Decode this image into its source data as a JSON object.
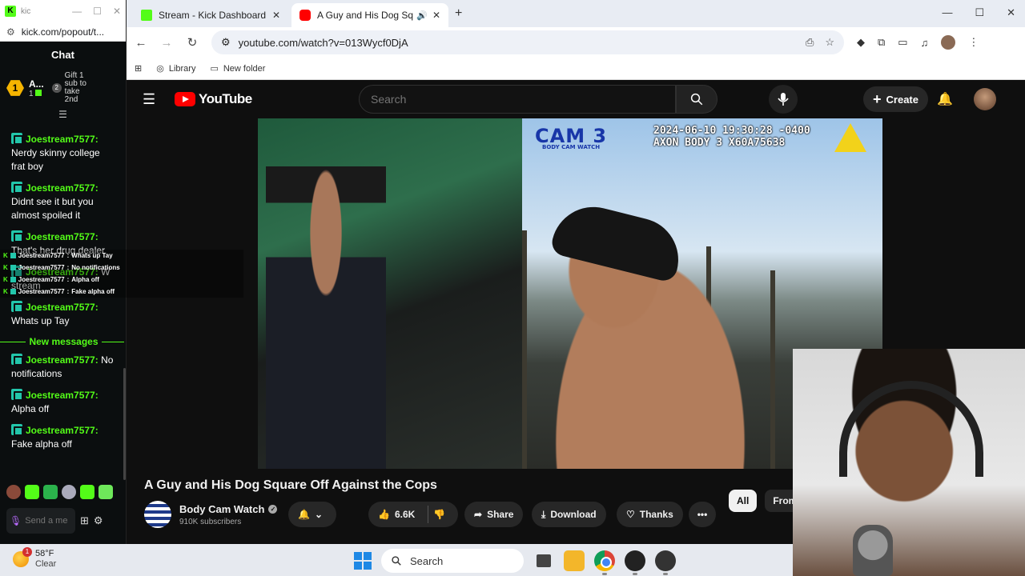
{
  "kick_popout": {
    "window_title": "kic",
    "url": "kick.com/popout/t...",
    "chat_header": "Chat",
    "gift_banner": {
      "rank": "1",
      "name": "A...",
      "count": "1",
      "second_rank": "2",
      "gift_text": "Gift 1 sub to take 2nd"
    },
    "messages": [
      {
        "user": "Joestream7577:",
        "text": "Nerdy skinny college frat boy"
      },
      {
        "user": "Joestream7577:",
        "text": "Didnt see it but you almost spoiled it"
      },
      {
        "user": "Joestream7577:",
        "text": "That's her drug dealer"
      },
      {
        "user": "Joestream7577:",
        "text": "W stream"
      },
      {
        "user": "Joestream7577:",
        "text": "Whats up Tay"
      }
    ],
    "new_messages_label": "New messages",
    "new_messages": [
      {
        "user": "Joestream7577:",
        "text": "No notifications"
      },
      {
        "user": "Joestream7577:",
        "text": "Alpha off"
      },
      {
        "user": "Joestream7577:",
        "text": "Fake alpha off"
      }
    ],
    "input_placeholder": "Send a message"
  },
  "overlay_chat": [
    {
      "user": "Joestream7577",
      "text": "Whats up Tay"
    },
    {
      "user": "Joestream7577",
      "text": "No notifications"
    },
    {
      "user": "Joestream7577",
      "text": "Alpha off"
    },
    {
      "user": "Joestream7577",
      "text": "Fake alpha off"
    }
  ],
  "browser": {
    "tabs": [
      {
        "title": "Stream - Kick Dashboard",
        "active": false
      },
      {
        "title": "A Guy and His Dog Square",
        "active": true
      }
    ],
    "url": "youtube.com/watch?v=013Wycf0DjA",
    "bookmarks": [
      "Library",
      "New folder"
    ]
  },
  "youtube": {
    "logo_text": "YouTube",
    "search_placeholder": "Search",
    "create_label": "Create",
    "video": {
      "cam_label": "CAM 3",
      "cam_sub": "BODY CAM WATCH",
      "timestamp": "2024-06-10 19:30:28 -0400",
      "device": "AXON BODY 3 X60A75638"
    },
    "title": "A Guy and His Dog Square Off Against the Cops",
    "channel": {
      "name": "Body Cam Watch",
      "subscribers": "910K subscribers"
    },
    "actions": {
      "likes": "6.6K",
      "share": "Share",
      "download": "Download",
      "thanks": "Thanks"
    },
    "chips": [
      "All",
      "From Body Cam Watc"
    ]
  },
  "taskbar": {
    "weather_temp": "58°F",
    "weather_desc": "Clear",
    "weather_badge": "1",
    "search_label": "Search"
  }
}
